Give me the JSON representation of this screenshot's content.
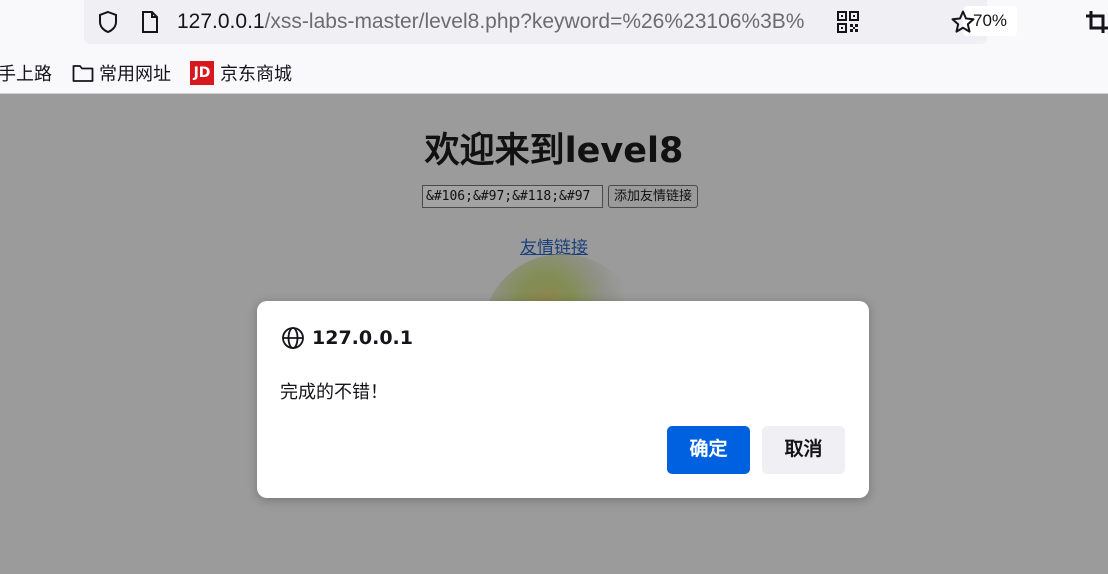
{
  "browser": {
    "url_host": "127.0.0.1",
    "url_path": "/xss-labs-master/level8.php?keyword=%26%23106%3B%",
    "zoom": "70%",
    "icons": [
      "shield-icon",
      "page-icon",
      "qr-code-icon",
      "star-icon",
      "crop-icon"
    ]
  },
  "bookmarks": [
    {
      "label": "手上路",
      "icon": "none"
    },
    {
      "label": "常用网址",
      "icon": "folder-icon"
    },
    {
      "label": "京东商城",
      "icon": "jd-logo",
      "logo_text": "JD",
      "logo_color": "#d7191f"
    }
  ],
  "page": {
    "title": "欢迎来到level8",
    "keyword_value": "&#106;&#97;&#118;&#97",
    "add_button": "添加友情链接",
    "friend_link": "友情链接"
  },
  "dialog": {
    "host": "127.0.0.1",
    "message": "完成的不错！",
    "ok_label": "确定",
    "cancel_label": "取消",
    "ok_color": "#0061e0"
  }
}
